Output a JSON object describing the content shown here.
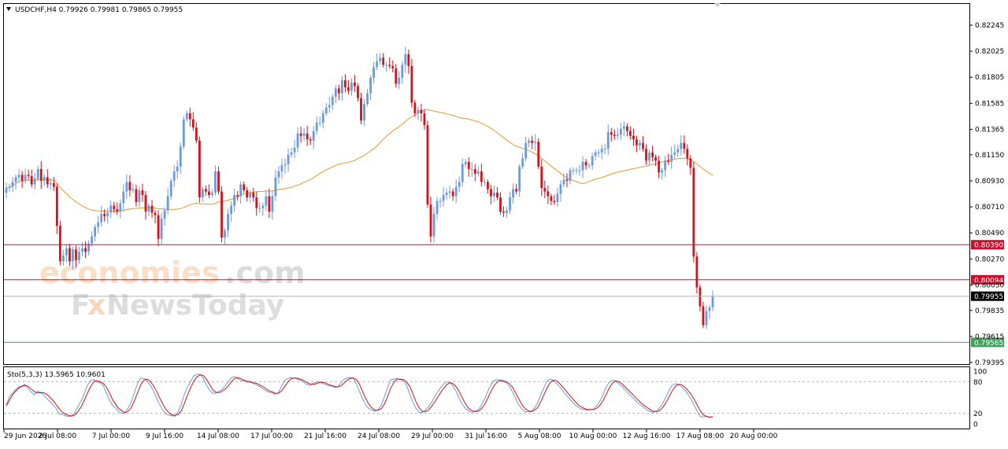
{
  "header": {
    "symbol_line": "USDCHF,H4  0.79926 0.79981 0.79865 0.79955"
  },
  "watermark": {
    "logo1_part1": "economies",
    "logo1_part2": ".com",
    "logo2_part1": "F",
    "logo2_part2": "x",
    "logo2_part3": "NewsToday"
  },
  "colors": {
    "bull": "#6b9ae0",
    "bear": "#d9101a",
    "ma": "#e29a2c",
    "stoch_main": "#6b9ae0",
    "stoch_signal": "#d9101a",
    "resistance": "#c8102e",
    "support": "#3da35d",
    "current": "#000000"
  },
  "chart_data": [
    {
      "type": "line",
      "title": "USDCHF,H4",
      "ylim": [
        0.793,
        0.8235
      ],
      "y_ticks": [
        "0.82245",
        "0.82025",
        "0.81805",
        "0.81585",
        "0.81365",
        "0.81150",
        "0.80930",
        "0.80710",
        "0.80490",
        "0.80270",
        "0.80050",
        "0.79835",
        "0.79615",
        "0.79395"
      ],
      "x_ticks": [
        "29 Jun 2026",
        "2 Jul 08:00",
        "7 Jul 00:00",
        "9 Jul 16:00",
        "14 Jul 08:00",
        "17 Jul 00:00",
        "21 Jul 16:00",
        "24 Jul 08:00",
        "29 Jul 00:00",
        "31 Jul 16:00",
        "5 Aug 08:00",
        "10 Aug 00:00",
        "12 Aug 16:00",
        "17 Aug 08:00",
        "20 Aug 00:00"
      ],
      "series": [
        {
          "values": [
            0.8087,
            0.8088,
            0.8092,
            0.8096,
            0.8098,
            0.8093,
            0.8098,
            0.8097,
            0.809,
            0.8095,
            0.8103,
            0.8093,
            0.8096,
            0.809,
            0.8091,
            0.8088,
            0.8055,
            0.8025,
            0.803,
            0.8036,
            0.8025,
            0.8035,
            0.8026,
            0.8033,
            0.8036,
            0.8033,
            0.804,
            0.8046,
            0.8054,
            0.8058,
            0.8065,
            0.8063,
            0.8066,
            0.8072,
            0.8069,
            0.8067,
            0.8074,
            0.8084,
            0.8092,
            0.8085,
            0.8086,
            0.8075,
            0.8085,
            0.8081,
            0.8067,
            0.8072,
            0.8066,
            0.8064,
            0.8044,
            0.8061,
            0.8068,
            0.808,
            0.8093,
            0.8101,
            0.8105,
            0.8122,
            0.8145,
            0.815,
            0.8145,
            0.8138,
            0.8127,
            0.8079,
            0.8086,
            0.8084,
            0.8081,
            0.8083,
            0.8101,
            0.8084,
            0.8045,
            0.8051,
            0.8065,
            0.8072,
            0.8081,
            0.808,
            0.809,
            0.8085,
            0.8079,
            0.8083,
            0.8079,
            0.807,
            0.807,
            0.8072,
            0.808,
            0.8067,
            0.808,
            0.8096,
            0.8101,
            0.8106,
            0.8107,
            0.8115,
            0.8117,
            0.8121,
            0.8133,
            0.8131,
            0.8133,
            0.8128,
            0.8127,
            0.8135,
            0.8142,
            0.8142,
            0.815,
            0.8155,
            0.8157,
            0.8164,
            0.8171,
            0.8167,
            0.8178,
            0.8172,
            0.8169,
            0.8176,
            0.8173,
            0.8163,
            0.8144,
            0.8158,
            0.8167,
            0.818,
            0.8189,
            0.8194,
            0.8197,
            0.8191,
            0.8191,
            0.819,
            0.8188,
            0.8175,
            0.818,
            0.8191,
            0.82,
            0.819,
            0.8159,
            0.815,
            0.8153,
            0.815,
            0.814,
            0.8073,
            0.8046,
            0.8065,
            0.8076,
            0.8076,
            0.8081,
            0.8083,
            0.8084,
            0.808,
            0.8088,
            0.8092,
            0.8107,
            0.8109,
            0.8103,
            0.8103,
            0.8099,
            0.8101,
            0.8092,
            0.8092,
            0.8086,
            0.808,
            0.8083,
            0.8079,
            0.8067,
            0.8066,
            0.8068,
            0.8079,
            0.8086,
            0.8084,
            0.8105,
            0.8112,
            0.8125,
            0.8127,
            0.8125,
            0.8126,
            0.8105,
            0.8087,
            0.8084,
            0.808,
            0.8076,
            0.8075,
            0.8082,
            0.809,
            0.8094,
            0.8093,
            0.8102,
            0.8102,
            0.8102,
            0.8102,
            0.8109,
            0.8106,
            0.8106,
            0.8114,
            0.8117,
            0.8117,
            0.812,
            0.812,
            0.8134,
            0.8132,
            0.8131,
            0.8132,
            0.8137,
            0.8139,
            0.8135,
            0.8131,
            0.8128,
            0.8123,
            0.8125,
            0.812,
            0.811,
            0.8117,
            0.8113,
            0.811,
            0.81,
            0.8102,
            0.811,
            0.8109,
            0.8115,
            0.8117,
            0.812,
            0.8125,
            0.812,
            0.8112,
            0.8104,
            0.8029,
            0.8003,
            0.7987,
            0.7971,
            0.7983,
            0.7986,
            0.7995
          ],
          "name": ""
        }
      ]
    },
    {
      "type": "line",
      "title": "Sto(5,3,3) 13.5965 10.9601",
      "ylim": [
        0,
        100
      ],
      "y_ticks": [
        "100",
        "80",
        "20",
        "0"
      ],
      "levels": [
        80,
        20
      ],
      "series": [
        {
          "name": "",
          "values": [
            36,
            52,
            58,
            65,
            70,
            72,
            75,
            67,
            60,
            55,
            62,
            60,
            54,
            48,
            42,
            36,
            29,
            18,
            18,
            15,
            14,
            15,
            22,
            34,
            44,
            58,
            74,
            82,
            84,
            79,
            78,
            73,
            59,
            45,
            35,
            30,
            23,
            20,
            21,
            30,
            42,
            59,
            77,
            87,
            86,
            82,
            74,
            64,
            50,
            37,
            27,
            19,
            17,
            15,
            15,
            23,
            38,
            56,
            70,
            81,
            91,
            94,
            94,
            87,
            74,
            64,
            58,
            58,
            62,
            65,
            72,
            80,
            87,
            90,
            86,
            83,
            81,
            79,
            79,
            77,
            74,
            71,
            67,
            63,
            60,
            59,
            56,
            59,
            70,
            82,
            86,
            88,
            87,
            85,
            83,
            80,
            75,
            73,
            76,
            79,
            80,
            78,
            75,
            73,
            72,
            69,
            70,
            77,
            84,
            87,
            88,
            87,
            76,
            61,
            47,
            36,
            29,
            26,
            24,
            27,
            36,
            52,
            69,
            84,
            85,
            86,
            84,
            83,
            74,
            58,
            42,
            30,
            22,
            21,
            26,
            32,
            40,
            51,
            60,
            69,
            76,
            80,
            78,
            71,
            61,
            47,
            36,
            29,
            24,
            22,
            24,
            27,
            35,
            47,
            61,
            74,
            82,
            84,
            82,
            80,
            78,
            71,
            60,
            47,
            36,
            28,
            23,
            23,
            24,
            30,
            40,
            55,
            69,
            81,
            85,
            82,
            77,
            71,
            63,
            55,
            49,
            42,
            36,
            31,
            28,
            27,
            26,
            27,
            28,
            35,
            44,
            57,
            71,
            79,
            83,
            81,
            76,
            71,
            64,
            58,
            52,
            46,
            40,
            35,
            31,
            26,
            23,
            22,
            24,
            30,
            38,
            51,
            63,
            73,
            76,
            75,
            70,
            65,
            57,
            48,
            36,
            24,
            14,
            13,
            14,
            12,
            14
          ]
        },
        {
          "name": "",
          "values": [
            34,
            45,
            55,
            62,
            68,
            71,
            73,
            71,
            66,
            61,
            59,
            59,
            59,
            56,
            50,
            44,
            36,
            28,
            22,
            18,
            16,
            15,
            17,
            24,
            33,
            45,
            59,
            71,
            80,
            82,
            80,
            77,
            70,
            59,
            46,
            37,
            29,
            25,
            21,
            24,
            31,
            44,
            59,
            74,
            83,
            85,
            81,
            73,
            63,
            50,
            38,
            28,
            21,
            17,
            16,
            18,
            25,
            39,
            55,
            69,
            81,
            89,
            93,
            92,
            85,
            75,
            65,
            60,
            59,
            62,
            66,
            72,
            80,
            86,
            88,
            86,
            83,
            81,
            80,
            78,
            77,
            74,
            71,
            67,
            63,
            61,
            58,
            58,
            62,
            70,
            79,
            85,
            87,
            87,
            85,
            83,
            79,
            76,
            75,
            76,
            78,
            79,
            78,
            75,
            73,
            71,
            70,
            72,
            77,
            83,
            86,
            87,
            84,
            75,
            61,
            48,
            37,
            30,
            26,
            26,
            29,
            38,
            52,
            68,
            79,
            85,
            85,
            84,
            80,
            72,
            58,
            43,
            31,
            24,
            23,
            26,
            33,
            41,
            50,
            60,
            68,
            75,
            78,
            76,
            70,
            60,
            48,
            37,
            29,
            25,
            23,
            24,
            29,
            36,
            48,
            61,
            72,
            79,
            83,
            82,
            80,
            76,
            69,
            58,
            47,
            36,
            29,
            25,
            23,
            26,
            31,
            42,
            55,
            68,
            78,
            83,
            82,
            77,
            70,
            63,
            56,
            49,
            42,
            36,
            32,
            29,
            27,
            27,
            27,
            30,
            36,
            45,
            57,
            69,
            78,
            81,
            80,
            76,
            70,
            64,
            58,
            52,
            46,
            40,
            35,
            31,
            27,
            24,
            23,
            25,
            31,
            40,
            51,
            62,
            71,
            75,
            74,
            70,
            64,
            57,
            47,
            36,
            25,
            17,
            14,
            13,
            13
          ]
        }
      ]
    }
  ],
  "levels": {
    "resistance_1": "0.80390",
    "resistance_2": "0.80094",
    "current": "0.79955",
    "support": "0.79565"
  }
}
